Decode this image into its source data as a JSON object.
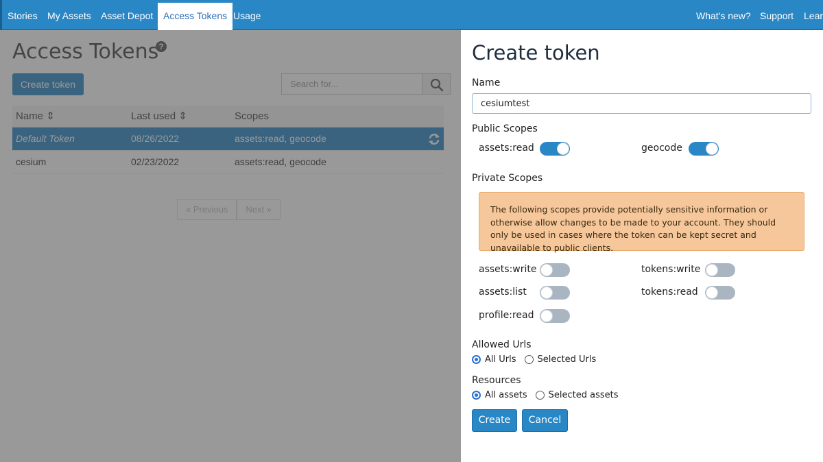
{
  "nav": {
    "items": [
      {
        "label": "Stories"
      },
      {
        "label": "My Assets"
      },
      {
        "label": "Asset Depot"
      },
      {
        "label": "Access Tokens",
        "active": true
      },
      {
        "label": "Usage"
      }
    ],
    "right_items": [
      {
        "label": "What's new?"
      },
      {
        "label": "Support"
      },
      {
        "label": "Lear"
      }
    ]
  },
  "list_page": {
    "title": "Access Tokens",
    "help_icon": "question-circle-icon",
    "create_button": "Create token",
    "search_placeholder": "Search for...",
    "columns": [
      "Name",
      "Last used",
      "Scopes"
    ],
    "rows": [
      {
        "name": "Default Token",
        "last_used": "08/26/2022",
        "scopes": "assets:read, geocode",
        "selected": true
      },
      {
        "name": "cesium",
        "last_used": "02/23/2022",
        "scopes": "assets:read, geocode"
      }
    ],
    "pager": {
      "previous": "« Previous",
      "next": "Next »"
    }
  },
  "form": {
    "title": "Create token",
    "name_label": "Name",
    "name_value": "cesiumtest",
    "public_scopes_label": "Public Scopes",
    "public_scopes": [
      {
        "label": "assets:read",
        "enabled": true
      },
      {
        "label": "geocode",
        "enabled": true
      }
    ],
    "private_scopes_label": "Private Scopes",
    "warning": "The following scopes provide potentially sensitive information or otherwise allow changes to be made to your account. They should only be used in cases where the token can be kept secret and unavailable to public clients.",
    "private_scopes": [
      {
        "label": "assets:write",
        "enabled": false
      },
      {
        "label": "tokens:write",
        "enabled": false
      },
      {
        "label": "assets:list",
        "enabled": false
      },
      {
        "label": "tokens:read",
        "enabled": false
      },
      {
        "label": "profile:read",
        "enabled": false
      }
    ],
    "allowed_urls_label": "Allowed Urls",
    "allowed_urls_options": [
      {
        "label": "All Urls",
        "checked": true
      },
      {
        "label": "Selected Urls",
        "checked": false
      }
    ],
    "resources_label": "Resources",
    "resources_options": [
      {
        "label": "All assets",
        "checked": true
      },
      {
        "label": "Selected assets",
        "checked": false
      }
    ],
    "create_button": "Create",
    "cancel_button": "Cancel"
  },
  "colors": {
    "accent": "#2a87c6",
    "warning_bg": "#f5c79a"
  }
}
